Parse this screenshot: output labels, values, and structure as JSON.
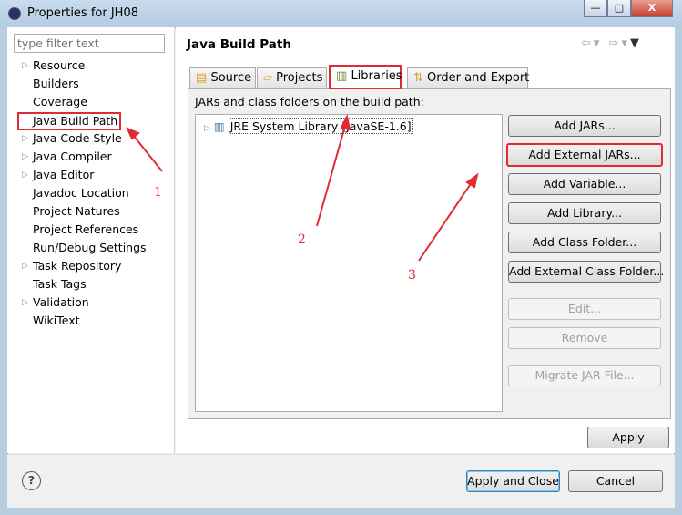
{
  "window": {
    "title": "Properties for JH08",
    "minimize": "—",
    "maximize": "□",
    "close": "X"
  },
  "filter": {
    "placeholder": "type filter text"
  },
  "tree": [
    {
      "label": "Resource",
      "expandable": true
    },
    {
      "label": "Builders",
      "expandable": false
    },
    {
      "label": "Coverage",
      "expandable": false
    },
    {
      "label": "Java Build Path",
      "expandable": false,
      "selected": true
    },
    {
      "label": "Java Code Style",
      "expandable": true
    },
    {
      "label": "Java Compiler",
      "expandable": true
    },
    {
      "label": "Java Editor",
      "expandable": true
    },
    {
      "label": "Javadoc Location",
      "expandable": false
    },
    {
      "label": "Project Natures",
      "expandable": false
    },
    {
      "label": "Project References",
      "expandable": false
    },
    {
      "label": "Run/Debug Settings",
      "expandable": false
    },
    {
      "label": "Task Repository",
      "expandable": true
    },
    {
      "label": "Task Tags",
      "expandable": false
    },
    {
      "label": "Validation",
      "expandable": true
    },
    {
      "label": "WikiText",
      "expandable": false
    }
  ],
  "main": {
    "title": "Java Build Path",
    "tabs": [
      {
        "label": "Source"
      },
      {
        "label": "Projects"
      },
      {
        "label": "Libraries",
        "selected": true
      },
      {
        "label": "Order and Export"
      }
    ],
    "list_label": "JARs and class folders on the build path:",
    "entries": [
      {
        "label": "JRE System Library [JavaSE-1.6]"
      }
    ],
    "buttons": [
      {
        "label": "Add JARs...",
        "enabled": true
      },
      {
        "label": "Add External JARs...",
        "enabled": true,
        "highlighted": true
      },
      {
        "label": "Add Variable...",
        "enabled": true
      },
      {
        "label": "Add Library...",
        "enabled": true
      },
      {
        "label": "Add Class Folder...",
        "enabled": true
      },
      {
        "label": "Add External Class Folder...",
        "enabled": true
      },
      {
        "label": "Edit...",
        "enabled": false
      },
      {
        "label": "Remove",
        "enabled": false
      },
      {
        "label": "Migrate JAR File...",
        "enabled": false
      }
    ],
    "apply": "Apply"
  },
  "footer": {
    "help": "?",
    "apply_close": "Apply and Close",
    "cancel": "Cancel"
  },
  "annotations": {
    "step1": "1",
    "step2": "2",
    "step3": "3",
    "color": "#e02b35"
  }
}
